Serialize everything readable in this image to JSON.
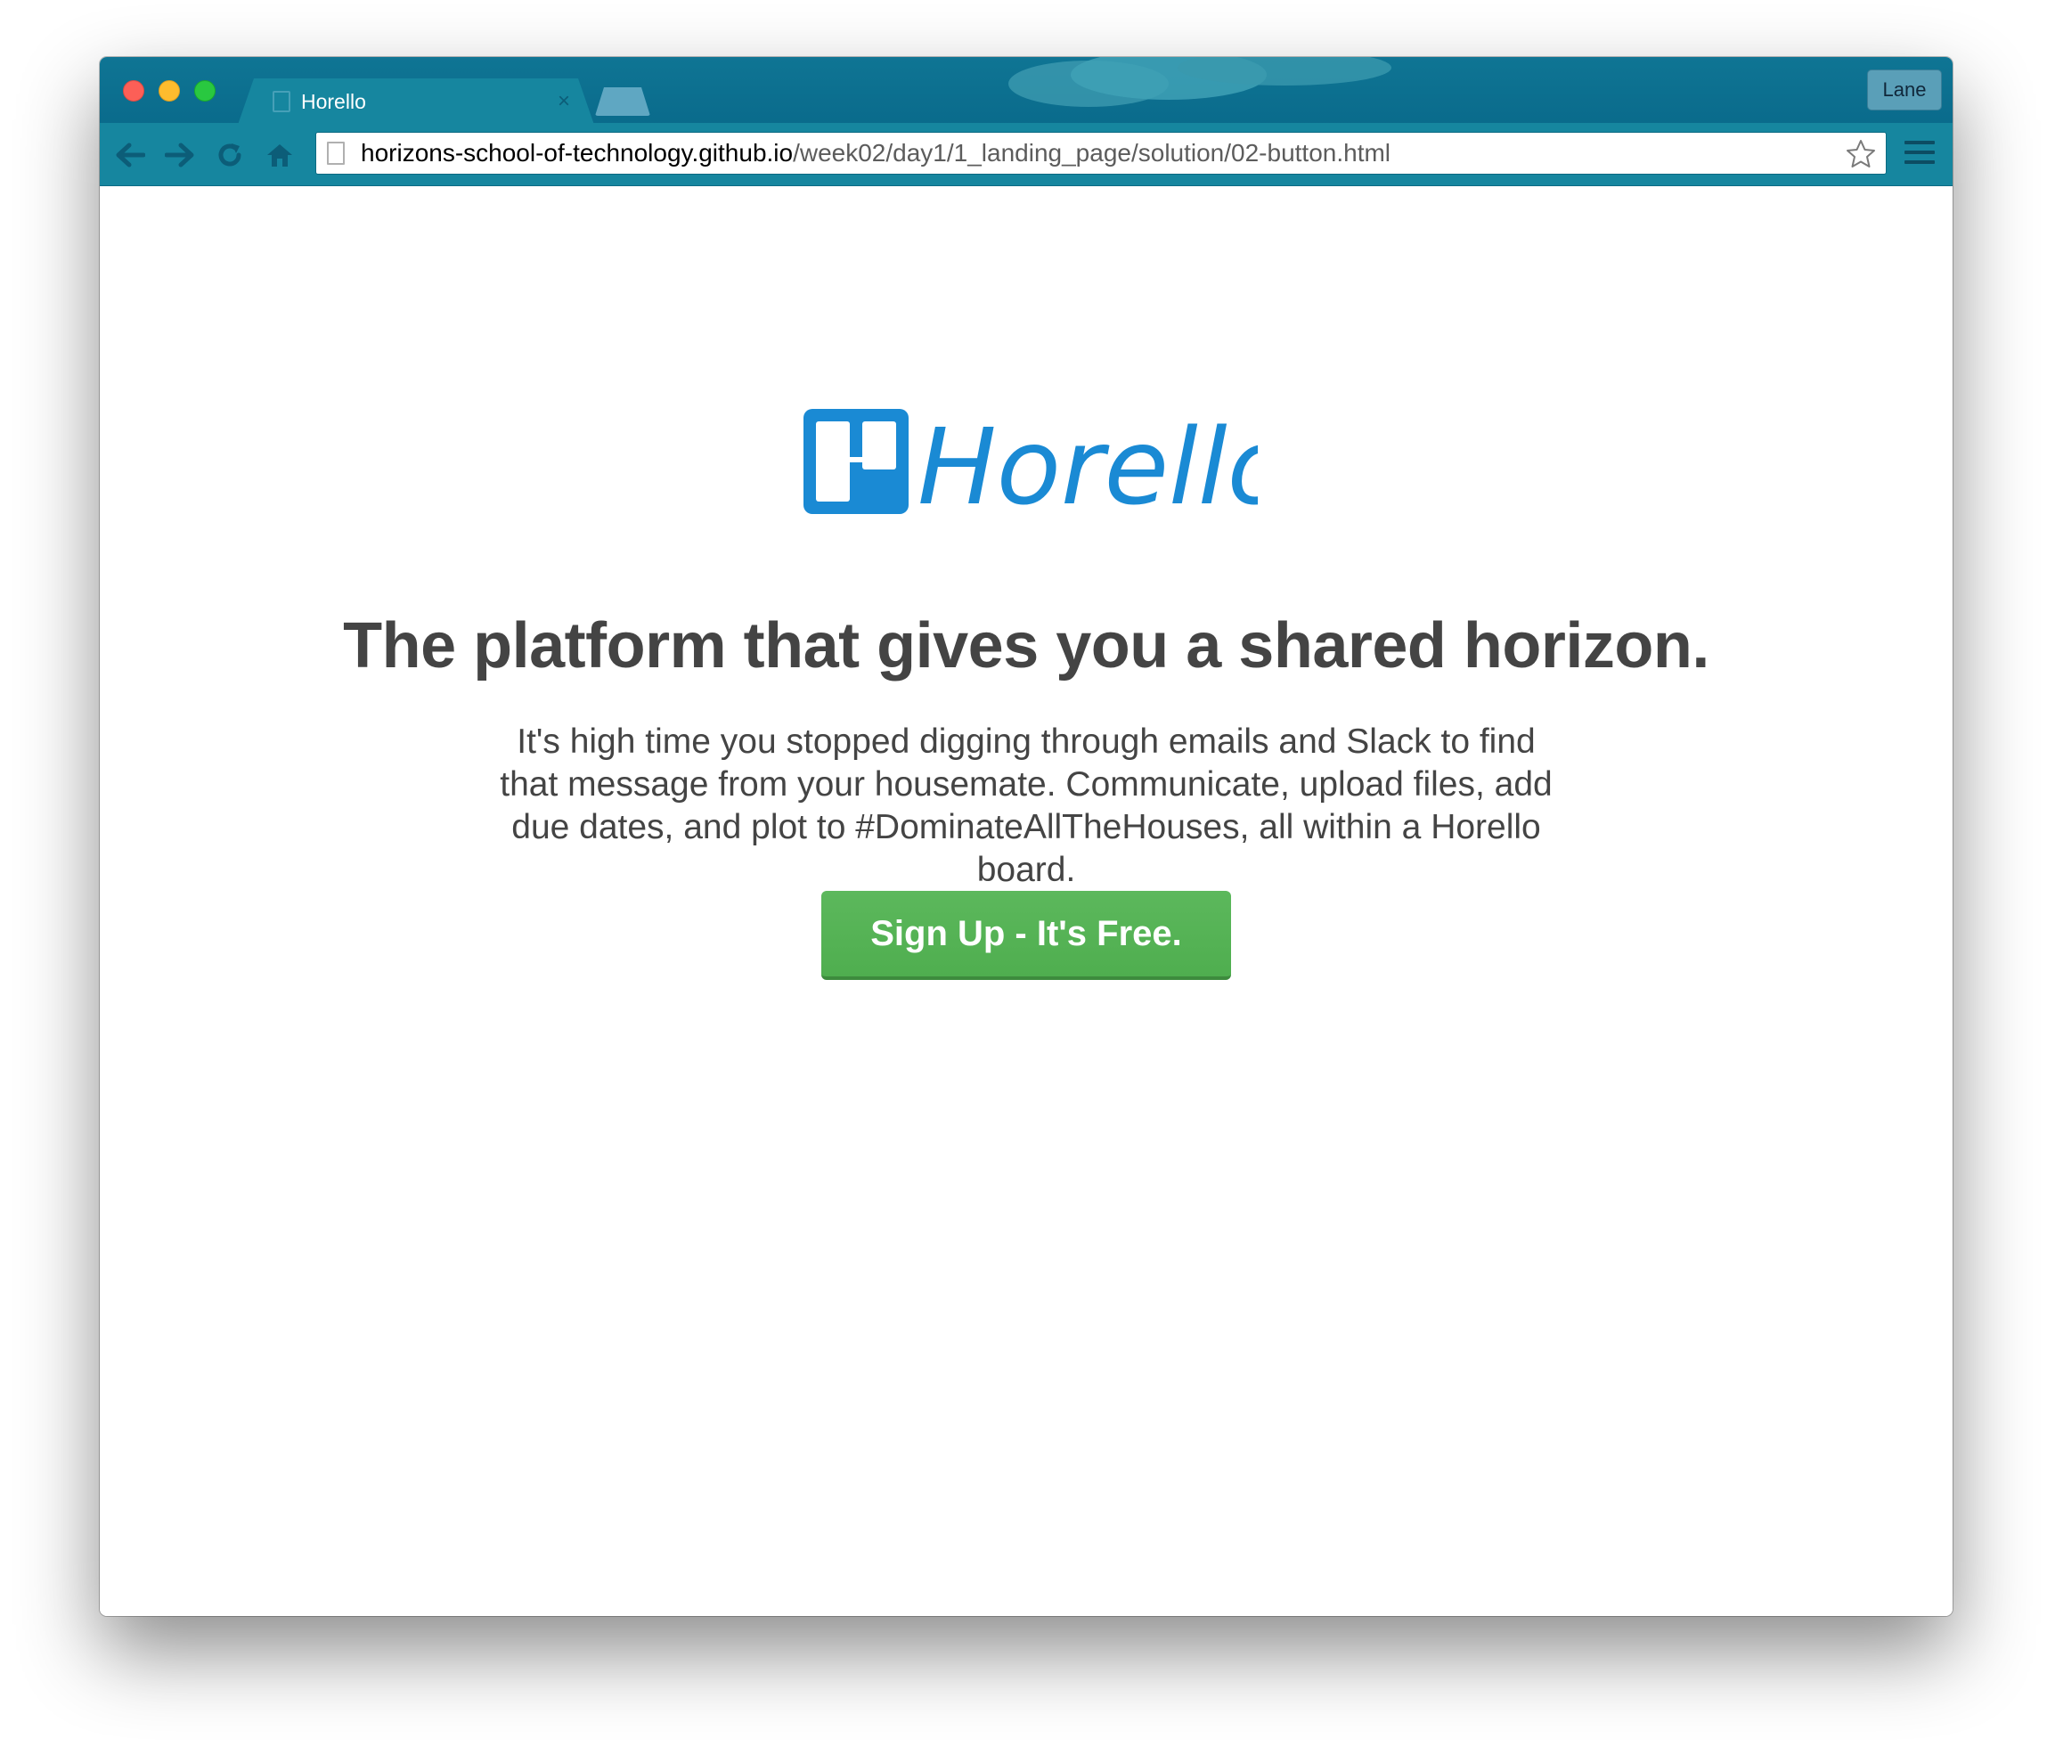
{
  "browser": {
    "tab": {
      "title": "Horello",
      "close_glyph": "×"
    },
    "profile_label": "Lane",
    "url": {
      "host": "horizons-school-of-technology.github.io",
      "path": "/week02/day1/1_landing_page/solution/02-button.html"
    },
    "icons": {
      "back": "back-arrow-icon",
      "forward": "forward-arrow-icon",
      "reload": "reload-icon",
      "home": "home-icon",
      "star": "star-icon",
      "menu": "hamburger-menu-icon"
    },
    "colors": {
      "titlebar": "#0f7594",
      "toolbar": "#16869f"
    }
  },
  "page": {
    "logo_text": "Horello",
    "logo_color": "#1a8ad4",
    "headline": "The platform that gives you a shared horizon.",
    "description": "It's high time you stopped digging through emails and Slack to find that message from your housemate. Communicate, upload files, add due dates, and plot to #DominateAllTheHouses, all within a Horello board.",
    "cta_label": "Sign Up - It's Free.",
    "cta_color": "#5cb85c"
  }
}
